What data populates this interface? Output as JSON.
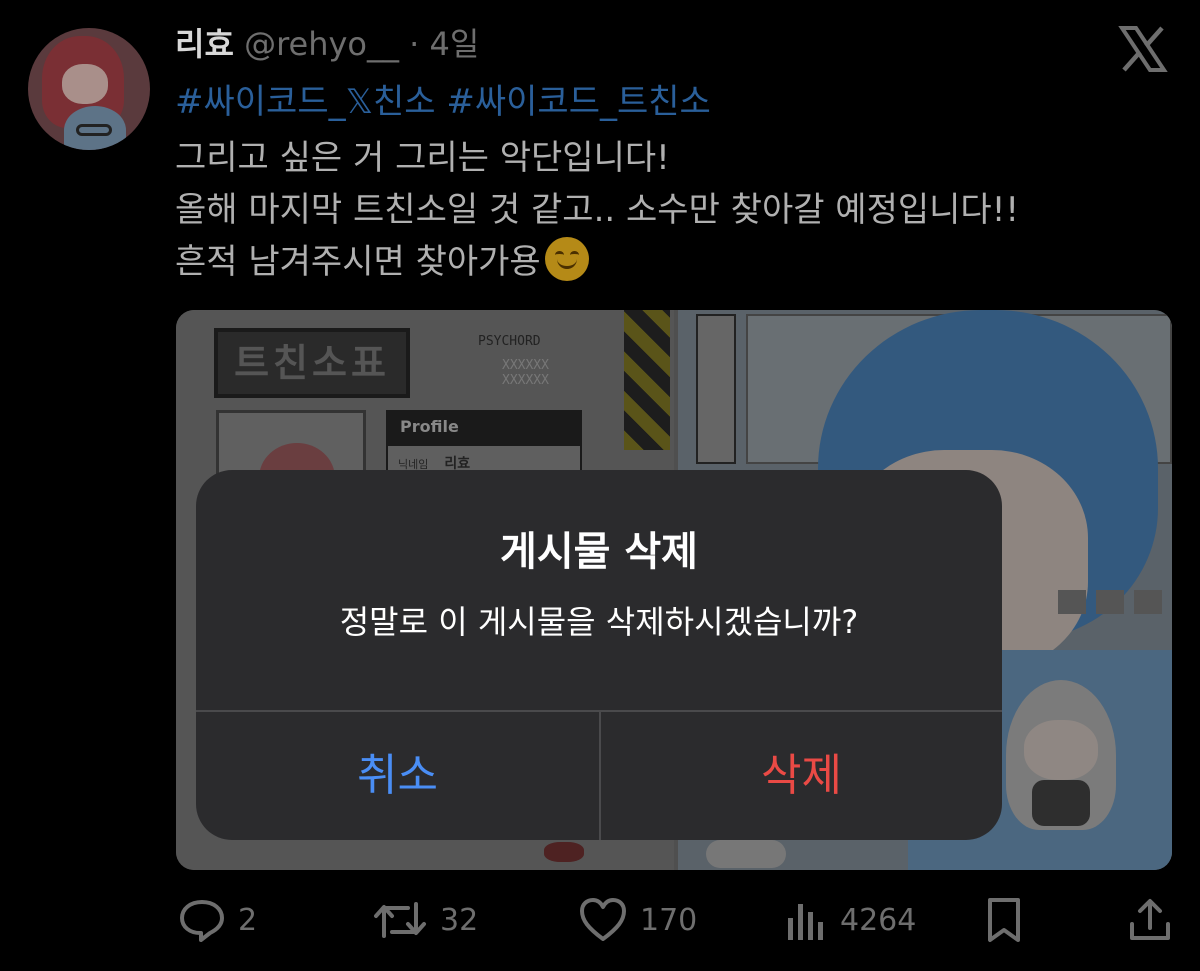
{
  "tweet": {
    "name": "리효",
    "handle": "@rehyo__",
    "separator": "·",
    "time": "4일",
    "hashtags": "#싸이코드_𝕏친소 #싸이코드_트친소",
    "lines": [
      "그리고 싶은 거 그리는 악단입니다!",
      "올해 마지막 트친소일 것 같고.. 소수만 찾아갈 예정입니다!!",
      "흔적 남겨주시면 찾아가용"
    ],
    "emoji": "smiling-face"
  },
  "media": {
    "logo_text": "트친소표",
    "brand": "PSYCHORD",
    "code_line1": "XXXXXX",
    "code_line2": "XXXXXX",
    "profile_header": "Profile",
    "profile_row_label": "닉네임",
    "profile_row_value": "리효"
  },
  "dialog": {
    "title": "게시물 삭제",
    "message": "정말로 이 게시물을 삭제하시겠습니까?",
    "cancel": "취소",
    "delete": "삭제"
  },
  "actions": {
    "replies": "2",
    "retweets": "32",
    "likes": "170",
    "views": "4264"
  },
  "colors": {
    "hashtag": "#2a5f9a",
    "cancel": "#4a8ef5",
    "delete": "#ea4a45",
    "dialog_bg": "#2b2b2d"
  }
}
